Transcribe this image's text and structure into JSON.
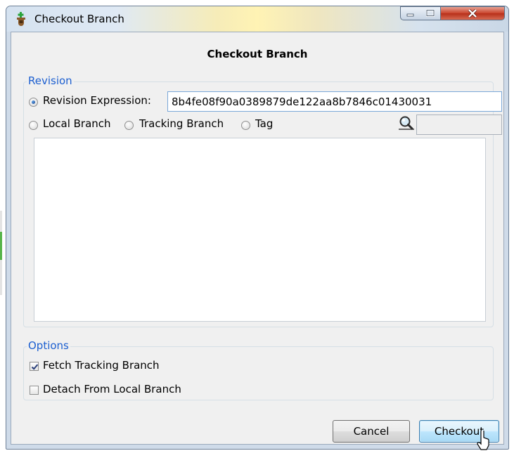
{
  "window": {
    "title": "Checkout Branch",
    "app_icon": "git-checkout-icon",
    "controls": [
      "minimize-icon",
      "maximize-icon",
      "close-icon"
    ]
  },
  "dialog": {
    "heading": "Checkout Branch"
  },
  "revision": {
    "legend": "Revision",
    "revision_expression_label": "Revision Expression:",
    "revision_expression_value": "8b4fe08f90a0389879de122aa8b7846c01430031",
    "revision_expression_selected": true,
    "local_branch_label": "Local Branch",
    "tracking_branch_label": "Tracking Branch",
    "tag_label": "Tag",
    "filter_icon": "search-icon",
    "filter_value": ""
  },
  "options": {
    "legend": "Options",
    "fetch_tracking_branch_label": "Fetch Tracking Branch",
    "fetch_tracking_branch_checked": true,
    "detach_from_local_branch_label": "Detach From Local Branch",
    "detach_from_local_branch_checked": false
  },
  "buttons": {
    "cancel": "Cancel",
    "checkout": "Checkout"
  },
  "colors": {
    "legend_text": "#1c5fd0",
    "dialog_background": "#f0f0f0",
    "window_frame": "#cfdbe9",
    "close_button": "#c8432b"
  }
}
